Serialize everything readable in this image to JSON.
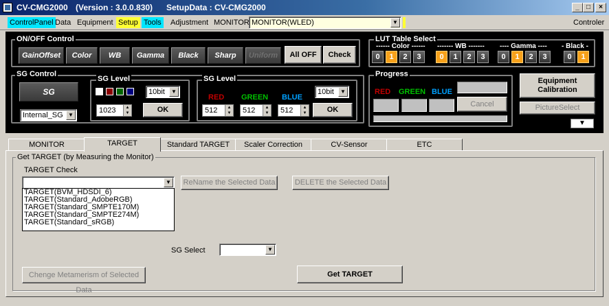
{
  "window": {
    "title": "CV-CMG2000",
    "version": "(Version : 3.0.0.830)",
    "setup_data": "SetupData : CV-CMG2000"
  },
  "menu": {
    "items": [
      "ControlPanel",
      "Data",
      "Equipment",
      "Setup",
      "Tools",
      "Adjustment",
      "MONITOR"
    ],
    "monitor_value": "MONITOR(WLED)",
    "controller": "Controler"
  },
  "onoff": {
    "title": "ON/OFF Control",
    "buttons": [
      "GainOffset",
      "Color",
      "WB",
      "Gamma",
      "Black",
      "Sharp",
      "Uniform"
    ],
    "all_off": "All OFF",
    "check": "Check"
  },
  "lut": {
    "title": "LUT Table Select",
    "color_label": "------ Color ------",
    "wb_label": "------- WB -------",
    "gamma_label": "---- Gamma ----",
    "black_label": "- Black -",
    "color": [
      "0",
      "1",
      "2",
      "3"
    ],
    "wb": [
      "0",
      "1",
      "2",
      "3"
    ],
    "gamma": [
      "0",
      "1",
      "2",
      "3"
    ],
    "black": [
      "0",
      "1"
    ],
    "selected": {
      "color": "1",
      "wb": "0",
      "gamma": "1",
      "black": "1"
    }
  },
  "sg_control": {
    "title": "SG Control",
    "sg_button": "SG",
    "source": "Internal_SG"
  },
  "sg_level1": {
    "title": "SG Level",
    "bits": "10bit",
    "value": "1023",
    "ok": "OK",
    "swatch_colors": [
      "#ffffff",
      "#8b0000",
      "#006400",
      "#000080"
    ]
  },
  "sg_level2": {
    "title": "SG Level",
    "red": "RED",
    "green": "GREEN",
    "blue": "BLUE",
    "bits": "10bit",
    "red_value": "512",
    "green_value": "512",
    "blue_value": "512",
    "ok": "OK"
  },
  "progress": {
    "title": "Progress",
    "red": "RED",
    "green": "GREEN",
    "blue": "BLUE",
    "cancel": "Cancel"
  },
  "side": {
    "equipment_calibration": "Equipment Calibration",
    "picture_select": "PictureSelect"
  },
  "tabs": [
    "MONITOR",
    "TARGET",
    "Standard TARGET",
    "Scaler Correction",
    "CV-Sensor",
    "ETC"
  ],
  "active_tab": "TARGET",
  "target": {
    "group_title": "Get TARGET (by Measuring the Monitor)",
    "check_label": "TARGET Check",
    "check_value": "",
    "list_items": [
      "TARGET(BVM_HDSDI_6)",
      "TARGET(Standard_AdobeRGB)",
      "TARGET(Standard_SMPTE170M)",
      "TARGET(Standard_SMPTE274M)",
      "TARGET(Standard_sRGB)"
    ],
    "rename_button": "ReName the Selected Data",
    "delete_button": "DELETE the Selected Data",
    "sg_select_label": "SG Select",
    "sg_select_value": "",
    "metamerism_button": "Chenge Metamerism of Selected Data",
    "get_target_button": "Get TARGET"
  }
}
